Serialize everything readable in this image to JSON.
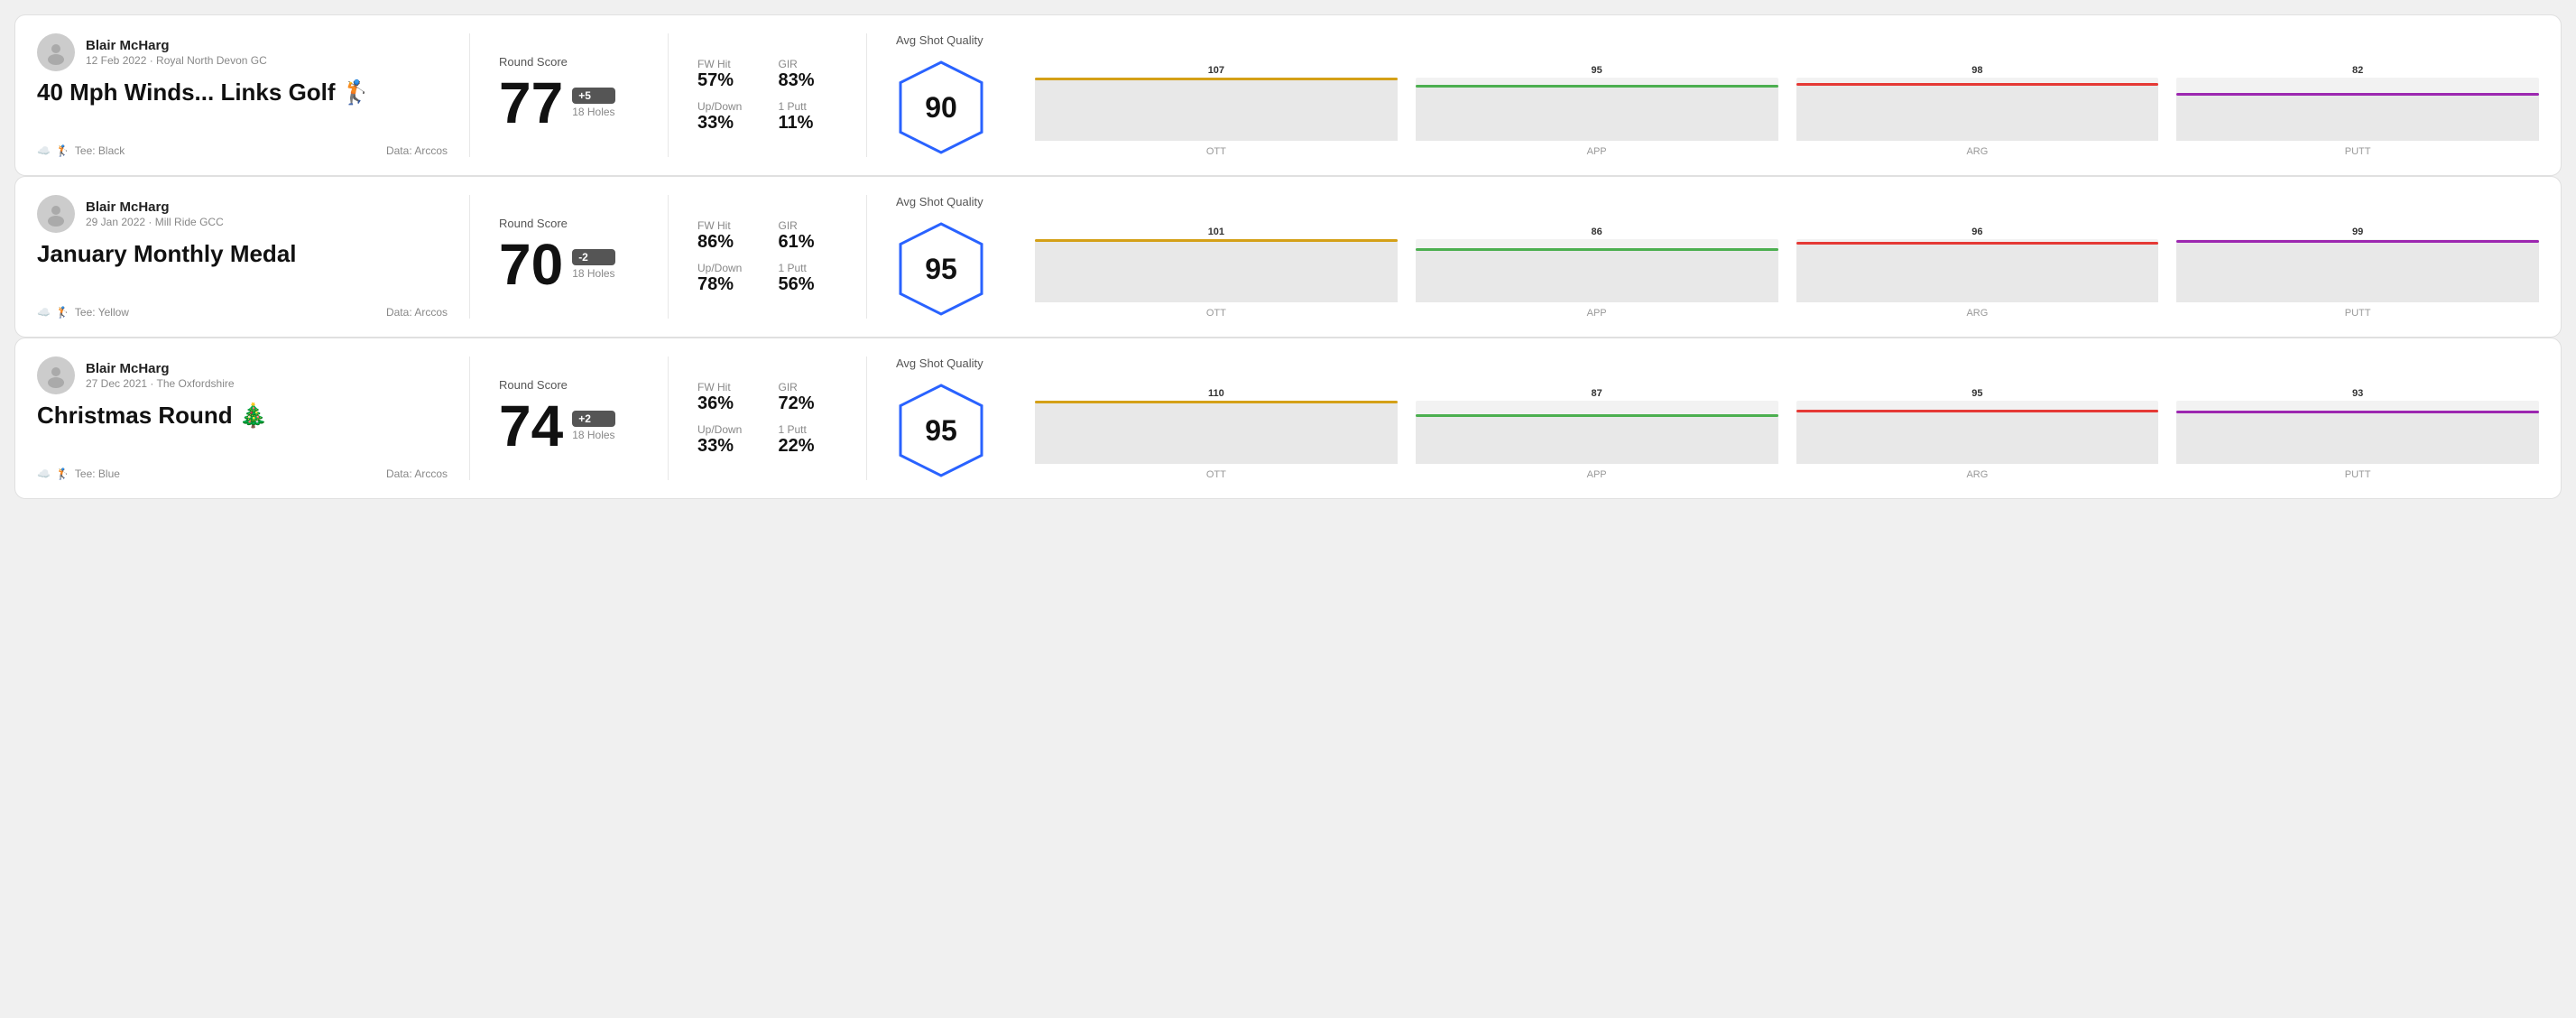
{
  "rounds": [
    {
      "id": "round1",
      "player": "Blair McHarg",
      "date_course": "12 Feb 2022 · Royal North Devon GC",
      "title": "40 Mph Winds... Links Golf 🏌️",
      "tee": "Tee: Black",
      "data_source": "Data: Arccos",
      "score": "77",
      "score_diff": "+5",
      "holes": "18 Holes",
      "fw_hit": "57%",
      "gir": "83%",
      "up_down": "33%",
      "one_putt": "11%",
      "avg_quality": "90",
      "chart": {
        "ott": {
          "value": 107,
          "pct": 100,
          "color": "#d4a017"
        },
        "app": {
          "value": 95,
          "pct": 88,
          "color": "#4caf50"
        },
        "arg": {
          "value": 98,
          "pct": 91,
          "color": "#e53935"
        },
        "putt": {
          "value": 82,
          "pct": 76,
          "color": "#9c27b0"
        }
      }
    },
    {
      "id": "round2",
      "player": "Blair McHarg",
      "date_course": "29 Jan 2022 · Mill Ride GCC",
      "title": "January Monthly Medal",
      "tee": "Tee: Yellow",
      "data_source": "Data: Arccos",
      "score": "70",
      "score_diff": "-2",
      "holes": "18 Holes",
      "fw_hit": "86%",
      "gir": "61%",
      "up_down": "78%",
      "one_putt": "56%",
      "avg_quality": "95",
      "chart": {
        "ott": {
          "value": 101,
          "pct": 100,
          "color": "#d4a017"
        },
        "app": {
          "value": 86,
          "pct": 85,
          "color": "#4caf50"
        },
        "arg": {
          "value": 96,
          "pct": 95,
          "color": "#e53935"
        },
        "putt": {
          "value": 99,
          "pct": 98,
          "color": "#9c27b0"
        }
      }
    },
    {
      "id": "round3",
      "player": "Blair McHarg",
      "date_course": "27 Dec 2021 · The Oxfordshire",
      "title": "Christmas Round 🎄",
      "tee": "Tee: Blue",
      "data_source": "Data: Arccos",
      "score": "74",
      "score_diff": "+2",
      "holes": "18 Holes",
      "fw_hit": "36%",
      "gir": "72%",
      "up_down": "33%",
      "one_putt": "22%",
      "avg_quality": "95",
      "chart": {
        "ott": {
          "value": 110,
          "pct": 100,
          "color": "#d4a017"
        },
        "app": {
          "value": 87,
          "pct": 79,
          "color": "#4caf50"
        },
        "arg": {
          "value": 95,
          "pct": 86,
          "color": "#e53935"
        },
        "putt": {
          "value": 93,
          "pct": 84,
          "color": "#9c27b0"
        }
      }
    }
  ],
  "labels": {
    "round_score": "Round Score",
    "fw_hit": "FW Hit",
    "gir": "GIR",
    "up_down": "Up/Down",
    "one_putt": "1 Putt",
    "avg_quality": "Avg Shot Quality",
    "data_arccos": "Data: Arccos",
    "ott": "OTT",
    "app": "APP",
    "arg": "ARG",
    "putt": "PUTT",
    "y100": "100",
    "y50": "50",
    "y0": "0"
  }
}
